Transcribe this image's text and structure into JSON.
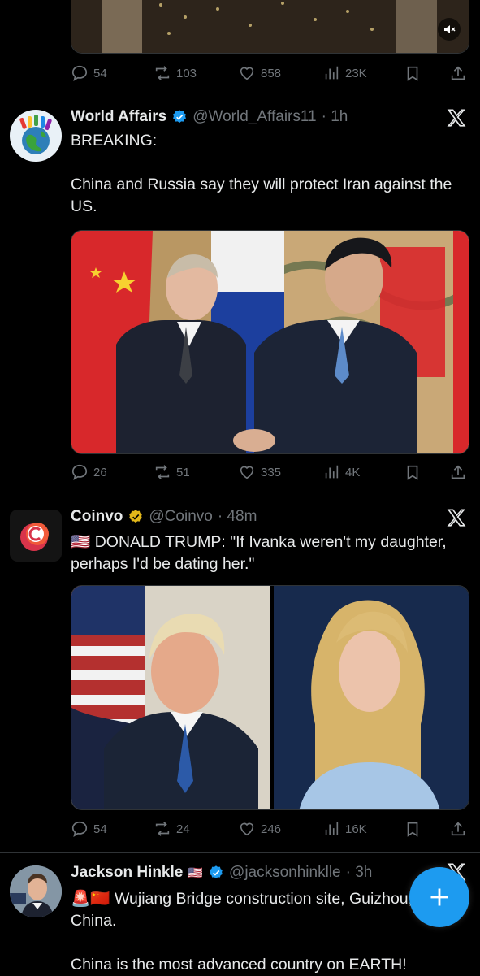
{
  "post0": {
    "actions": {
      "replies": "54",
      "reposts": "103",
      "likes": "858",
      "views": "23K"
    }
  },
  "post1": {
    "name": "World Affairs",
    "handle": "@World_Affairs11",
    "time": "· 1h",
    "text": "BREAKING:\n\nChina and Russia say they will protect Iran against the US.",
    "actions": {
      "replies": "26",
      "reposts": "51",
      "likes": "335",
      "views": "4K"
    }
  },
  "post2": {
    "name": "Coinvo",
    "handle": "@Coinvo",
    "time": "· 48m",
    "text": "🇺🇸 DONALD TRUMP: \"If Ivanka weren't my daughter, perhaps I'd be dating her.\"",
    "actions": {
      "replies": "54",
      "reposts": "24",
      "likes": "246",
      "views": "16K"
    }
  },
  "post3": {
    "name": "Jackson Hinkle",
    "flag": "🇺🇸",
    "handle": "@jacksonhinklle",
    "time": "· 3h",
    "text": "🚨🇨🇳 Wujiang Bridge construction site, Guizhou, China.\n\nChina is the most advanced country on EARTH!"
  },
  "colors": {
    "background": "#000000",
    "text": "#e7e9ea",
    "muted": "#71767b",
    "accent": "#1d9bf0",
    "gold": "#e2b719",
    "divider": "#2f3336"
  }
}
